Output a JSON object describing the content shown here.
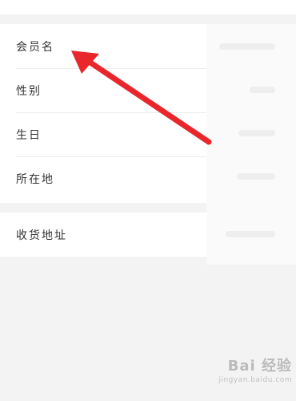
{
  "profile_rows": [
    {
      "label": "会员名"
    },
    {
      "label": "性别"
    },
    {
      "label": "生日"
    },
    {
      "label": "所在地"
    }
  ],
  "address_row": {
    "label": "收货地址"
  },
  "annotation": {
    "arrow_color": "#e8262b"
  },
  "watermark": {
    "main": "Bai 经验",
    "sub": "jingyan.baidu.com"
  }
}
